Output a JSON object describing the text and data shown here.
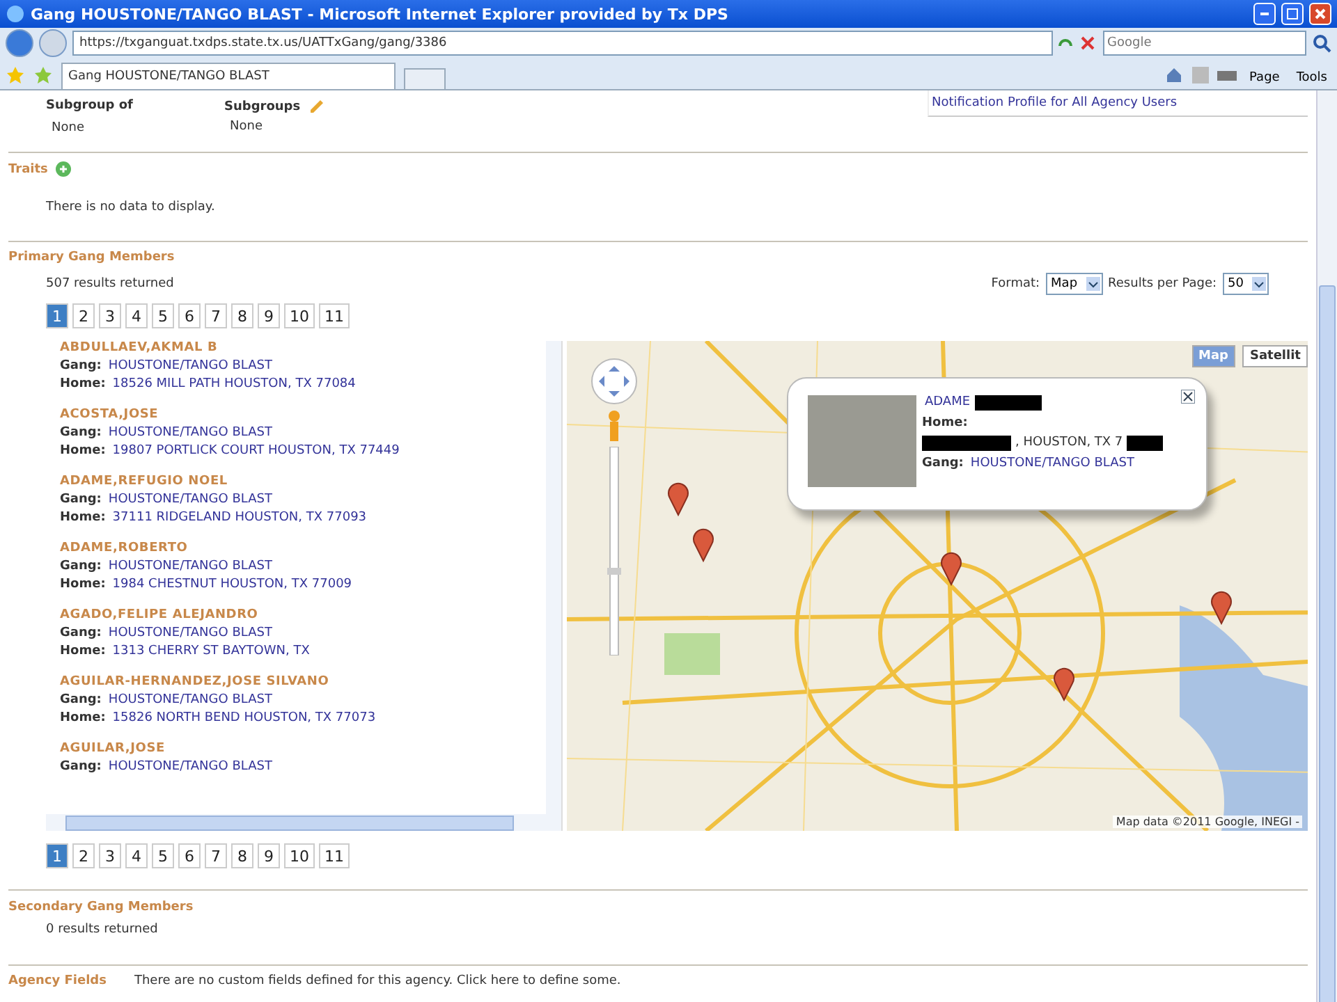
{
  "window": {
    "title": "Gang HOUSTONE/TANGO BLAST - Microsoft Internet Explorer provided by Tx DPS"
  },
  "address_bar": {
    "url": "https://txganguat.txdps.state.tx.us/UATTxGang/gang/3386",
    "search_placeholder": "Google"
  },
  "tab": {
    "title": "Gang HOUSTONE/TANGO BLAST"
  },
  "command_bar": {
    "buttons": [
      "Page",
      "Tools"
    ]
  },
  "subgroup_of": {
    "label": "Subgroup of",
    "value": "None"
  },
  "subgroups": {
    "label": "Subgroups",
    "value": "None"
  },
  "notification_link": "Notification Profile for All Agency Users",
  "traits": {
    "heading": "Traits",
    "empty_text": "There is no data to display."
  },
  "primary": {
    "heading": "Primary Gang Members",
    "count": "507 results returned",
    "format_label": "Format:",
    "format_value": "Map",
    "per_page_label": "Results per Page:",
    "per_page_value": "50"
  },
  "pages_top": [
    {
      "label": "1",
      "selected": true
    },
    {
      "label": "2",
      "selected": false
    },
    {
      "label": "3",
      "selected": false
    },
    {
      "label": "4",
      "selected": false
    },
    {
      "label": "5",
      "selected": false
    },
    {
      "label": "6",
      "selected": false
    },
    {
      "label": "7",
      "selected": false
    },
    {
      "label": "8",
      "selected": false
    },
    {
      "label": "9",
      "selected": false
    },
    {
      "label": "10",
      "selected": false
    },
    {
      "label": "11",
      "selected": false
    }
  ],
  "members": [
    {
      "name": "ABDULLAEV,AKMAL B",
      "gang_label": "Gang:",
      "gang": "HOUSTONE/TANGO BLAST",
      "home_label": "Home:",
      "home": "18526 MILL PATH HOUSTON, TX 77084"
    },
    {
      "name": "ACOSTA,JOSE",
      "gang_label": "Gang:",
      "gang": "HOUSTONE/TANGO BLAST",
      "home_label": "Home:",
      "home": "19807 PORTLICK COURT HOUSTON, TX 77449"
    },
    {
      "name": "ADAME,REFUGIO NOEL",
      "gang_label": "Gang:",
      "gang": "HOUSTONE/TANGO BLAST",
      "home_label": "Home:",
      "home": "37111 RIDGELAND HOUSTON, TX 77093"
    },
    {
      "name": "ADAME,ROBERTO",
      "gang_label": "Gang:",
      "gang": "HOUSTONE/TANGO BLAST",
      "home_label": "Home:",
      "home": "1984 CHESTNUT HOUSTON, TX 77009"
    },
    {
      "name": "AGADO,FELIPE ALEJANDRO",
      "gang_label": "Gang:",
      "gang": "HOUSTONE/TANGO BLAST",
      "home_label": "Home:",
      "home": "1313 CHERRY ST BAYTOWN, TX"
    },
    {
      "name": "AGUILAR-HERNANDEZ,JOSE SILVANO",
      "gang_label": "Gang:",
      "gang": "HOUSTONE/TANGO BLAST",
      "home_label": "Home:",
      "home": "15826 NORTH BEND HOUSTON, TX 77073"
    },
    {
      "name": "AGUILAR,JOSE",
      "gang_label": "Gang:",
      "gang": "HOUSTONE/TANGO BLAST"
    }
  ],
  "map": {
    "types": [
      {
        "label": "Map",
        "selected": true
      },
      {
        "label": "Satellit",
        "selected": false
      }
    ],
    "popup": {
      "name": "ADAME",
      "home_label": "Home:",
      "home": ", HOUSTON, TX 7",
      "gang_label": "Gang:",
      "gang": "HOUSTONE/TANGO BLAST"
    },
    "attribution": "Map data ©2011 Google, INEGI -",
    "zoom": {
      "level": 0.4
    }
  },
  "pages_bottom": [
    {
      "label": "1",
      "selected": true
    },
    {
      "label": "2",
      "selected": false
    },
    {
      "label": "3",
      "selected": false
    },
    {
      "label": "4",
      "selected": false
    },
    {
      "label": "5",
      "selected": false
    },
    {
      "label": "6",
      "selected": false
    },
    {
      "label": "7",
      "selected": false
    },
    {
      "label": "8",
      "selected": false
    },
    {
      "label": "9",
      "selected": false
    },
    {
      "label": "10",
      "selected": false
    },
    {
      "label": "11",
      "selected": false
    }
  ],
  "secondary": {
    "heading": "Secondary Gang Members",
    "count": "0 results returned"
  },
  "agency_fields": {
    "heading": "Agency Fields",
    "text": "There are no custom fields defined for this agency. Click here to define some."
  }
}
